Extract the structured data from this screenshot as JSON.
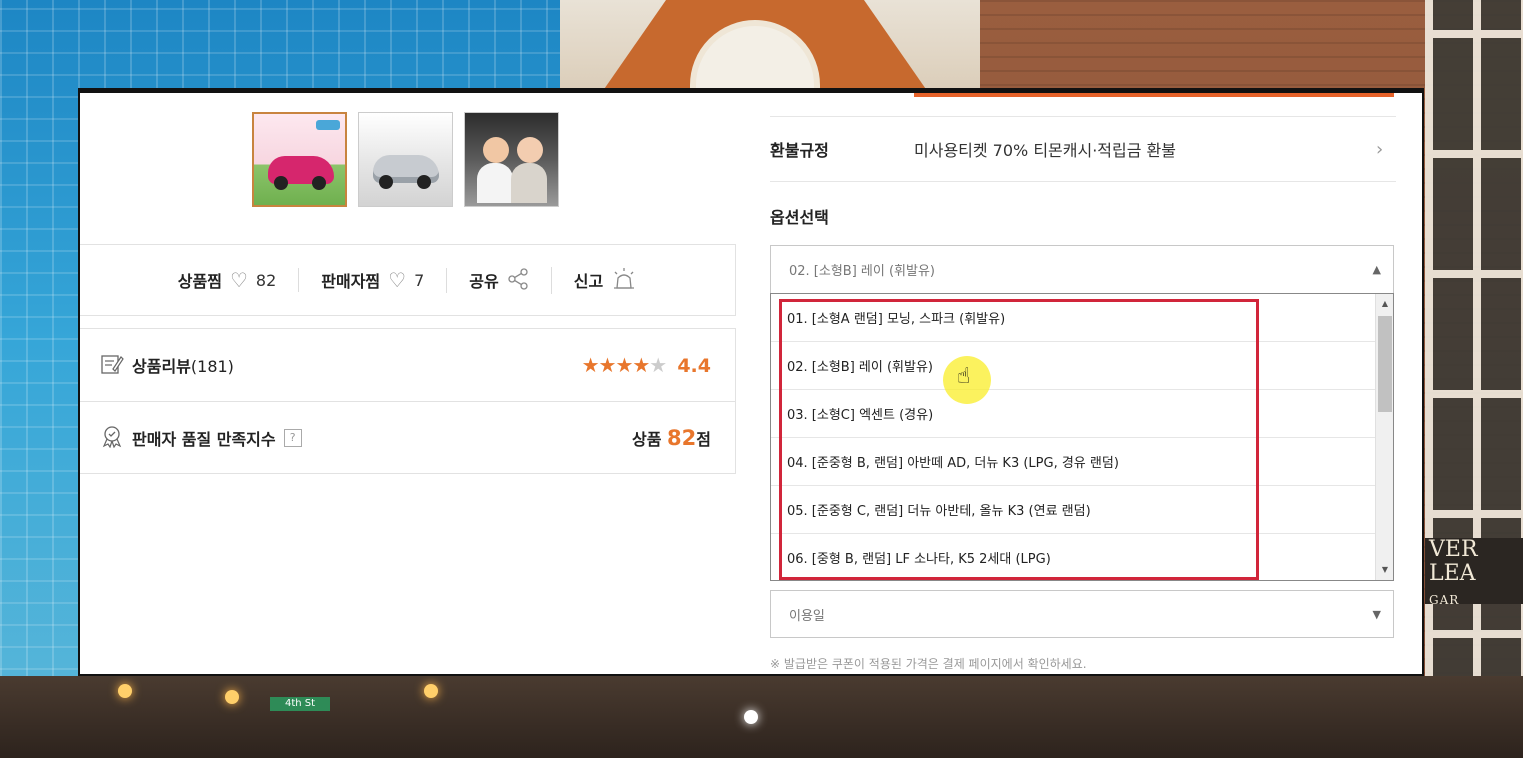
{
  "background": {
    "street_sign": "4th St",
    "store_sign_line1": "VER LEA",
    "store_sign_line2": "GAR LOUNGE"
  },
  "gallery": {
    "thumbnails": [
      {
        "name": "pink-car-thumbnail",
        "selected": true
      },
      {
        "name": "silver-sedan-thumbnail",
        "selected": false
      },
      {
        "name": "couple-in-car-thumbnail",
        "selected": false
      }
    ]
  },
  "actions": {
    "wish_label": "상품찜",
    "wish_count": "82",
    "seller_wish_label": "판매자찜",
    "seller_wish_count": "7",
    "share_label": "공유",
    "report_label": "신고"
  },
  "reviews": {
    "label": "상품리뷰",
    "count": "(181)",
    "rating": "4.4",
    "rating_value": 4.4
  },
  "seller_quality": {
    "label": "판매자 품질 만족지수",
    "help": "?",
    "score_prefix": "상품",
    "score": "82",
    "score_suffix": "점"
  },
  "refund": {
    "label": "환불규정",
    "value": "미사용티켓 70% 티몬캐시·적립금 환불",
    "arrow": "›"
  },
  "options": {
    "title": "옵션선택",
    "selected": "02. [소형B] 레이 (휘발유)",
    "items": [
      "01. [소형A 랜덤] 모닝, 스파크 (휘발유)",
      "02. [소형B] 레이 (휘발유)",
      "03. [소형C] 엑센트 (경유)",
      "04. [준중형 B, 랜덤] 아반떼 AD, 더뉴 K3 (LPG, 경유 랜덤)",
      "05. [준중형 C, 랜덤] 더뉴 아반테, 올뉴 K3 (연료 랜덤)",
      "06. [중형 B, 랜덤] LF 소나타, K5 2세대 (LPG)"
    ]
  },
  "date": {
    "placeholder": "이용일"
  },
  "note": "※ 발급받은 쿠폰이 적용된 가격은 결제 페이지에서 확인하세요.",
  "colors": {
    "accent": "#e8762c",
    "highlight_border": "#d1253a",
    "cursor_halo": "#faee28"
  }
}
